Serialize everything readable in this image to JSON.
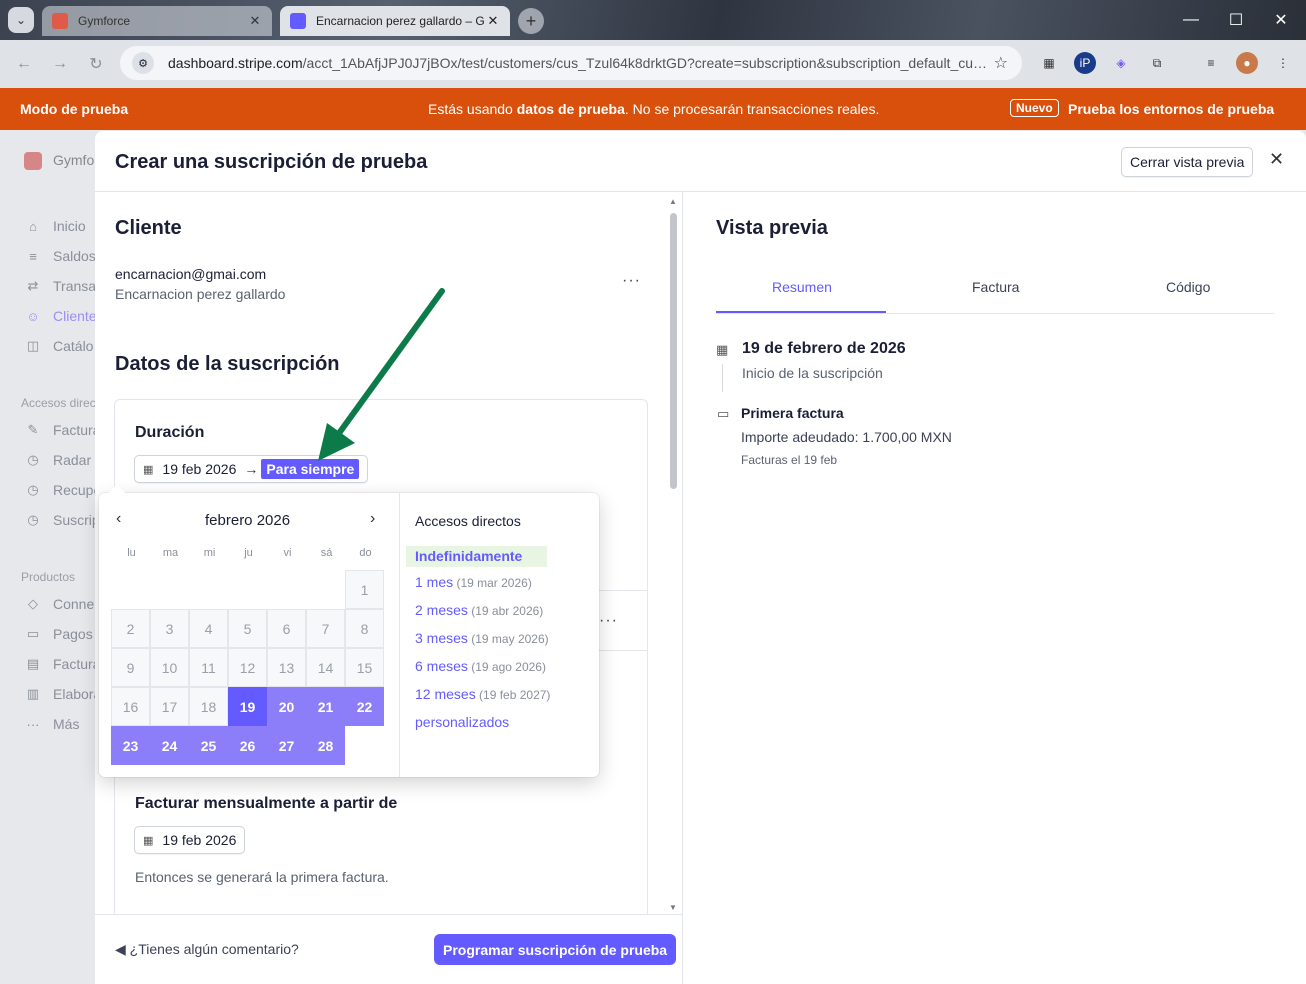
{
  "browser": {
    "tabs": [
      {
        "title": "Gymforce",
        "active": false
      },
      {
        "title": "Encarnacion perez gallardo – G",
        "active": true
      }
    ],
    "url_domain": "dashboard.stripe.com",
    "url_path": "/acct_1AbAfjJPJ0J7jBOx/test/customers/cus_Tzul64k8drktGD?create=subscription&subscription_default_custo..."
  },
  "banner": {
    "left": "Modo de prueba",
    "center_prefix": "Estás usando ",
    "center_bold": "datos de prueba",
    "center_suffix": ". No se procesarán transacciones reales.",
    "badge": "Nuevo",
    "right": "Prueba los entornos de prueba"
  },
  "dashboard": {
    "brand": "Gymfo",
    "sidebar": [
      {
        "label": "Inicio",
        "icon": "home-icon"
      },
      {
        "label": "Saldos",
        "icon": "balance-icon"
      },
      {
        "label": "Transa",
        "icon": "transfer-icon"
      },
      {
        "label": "Cliente",
        "icon": "user-icon",
        "selected": true
      },
      {
        "label": "Catálo",
        "icon": "box-icon"
      }
    ],
    "section_shortcuts": "Accesos direct",
    "shortcuts": [
      {
        "label": "Factura",
        "icon": "pin-icon"
      },
      {
        "label": "Radar",
        "icon": "clock-icon"
      },
      {
        "label": "Recupe",
        "icon": "clock-icon"
      },
      {
        "label": "Suscrip",
        "icon": "clock-icon"
      }
    ],
    "section_products": "Productos",
    "products": [
      {
        "label": "Conne",
        "icon": "layers-icon"
      },
      {
        "label": "Pagos",
        "icon": "wallet-icon"
      },
      {
        "label": "Factura",
        "icon": "invoice-icon"
      },
      {
        "label": "Elabora",
        "icon": "chart-icon"
      },
      {
        "label": "Más",
        "icon": "more-icon"
      }
    ]
  },
  "modal": {
    "title": "Crear una suscripción de prueba",
    "close_preview": "Cerrar vista previa",
    "customer": {
      "heading": "Cliente",
      "email": "encarnacion@gmai.com",
      "name": "Encarnacion perez gallardo"
    },
    "subscription": {
      "heading": "Datos de la suscripción",
      "duration_label": "Duración",
      "start_date": "19 feb 2026",
      "end_label": "Para siempre",
      "billing_label": "Facturar mensualmente a partir de",
      "billing_date": "19 feb 2026",
      "billing_hint": "Entonces se generará la primera factura."
    },
    "footer": {
      "feedback": "¿Tienes algún comentario?",
      "submit": "Programar suscripción de prueba"
    }
  },
  "preview": {
    "heading": "Vista previa",
    "tabs": [
      "Resumen",
      "Factura",
      "Código"
    ],
    "active_tab": "Resumen",
    "start_date": "19 de febrero de 2026",
    "start_label": "Inicio de la suscripción",
    "invoice_title": "Primera factura",
    "invoice_amount": "Importe adeudado: 1.700,00 MXN",
    "invoice_date": "Facturas el 19 feb"
  },
  "datepicker": {
    "month": "febrero 2026",
    "weekdays": [
      "lu",
      "ma",
      "mi",
      "ju",
      "vi",
      "sá",
      "do"
    ],
    "selected_day": 19,
    "shortcuts_title": "Accesos directos",
    "shortcuts": [
      {
        "label": "Indefinidamente",
        "date": "",
        "selected": true
      },
      {
        "label": "1 mes",
        "date": "(19 mar 2026)"
      },
      {
        "label": "2 meses",
        "date": "(19 abr 2026)"
      },
      {
        "label": "3 meses",
        "date": "(19 may 2026)"
      },
      {
        "label": "6 meses",
        "date": "(19 ago 2026)"
      },
      {
        "label": "12 meses",
        "date": "(19 feb 2027)"
      },
      {
        "label": "personalizados",
        "date": ""
      }
    ]
  },
  "colors": {
    "accent": "#635bff",
    "banner": "#d8500c",
    "arrow": "#0d7a4a"
  }
}
